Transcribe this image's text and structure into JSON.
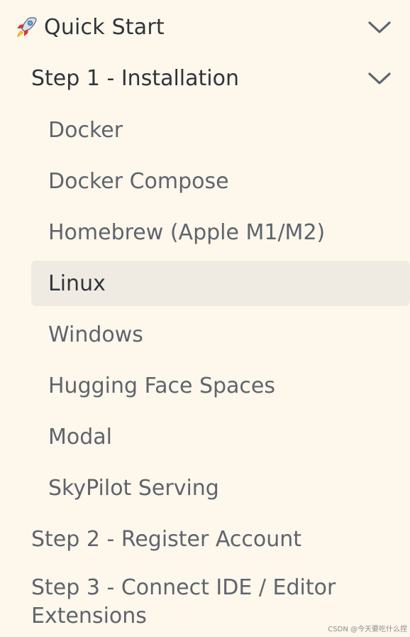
{
  "sidebar": {
    "section": {
      "label": "Quick Start",
      "icon": "rocket-icon"
    },
    "step1": {
      "label": "Step 1 - Installation"
    },
    "install_items": [
      "Docker",
      "Docker Compose",
      "Homebrew (Apple M1/M2)",
      "Linux",
      "Windows",
      "Hugging Face Spaces",
      "Modal",
      "SkyPilot Serving"
    ],
    "active_item": "Linux",
    "step2": {
      "label": "Step 2 - Register Account"
    },
    "step3": {
      "label": "Step 3 - Connect IDE / Editor Extensions"
    }
  },
  "watermark": "CSDN @今天要吃什么捏",
  "colors": {
    "background": "#fdf7ec",
    "active_background": "#f0ebe2",
    "text_primary": "#30343a",
    "text_secondary": "#5f646c",
    "chevron": "#5f646c"
  }
}
